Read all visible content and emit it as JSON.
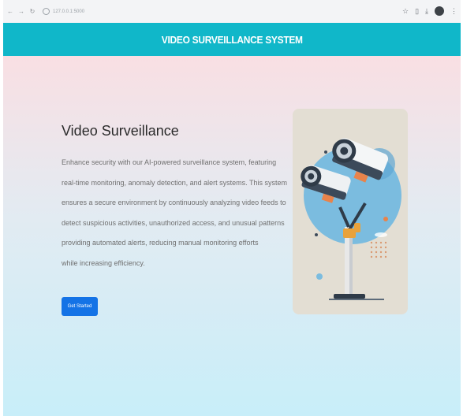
{
  "browser": {
    "url": "127.0.0.1:5000"
  },
  "header": {
    "title": "VIDEO SURVEILLANCE SYSTEM"
  },
  "hero": {
    "title": "Video Surveillance",
    "description": "Enhance security with our AI-powered surveillance system, featuring\nreal-time monitoring, anomaly detection, and alert systems. This system\nensures a secure environment by continuously analyzing video feeds to\ndetect suspicious activities, unauthorized access, and unusual patterns\nproviding automated alerts, reducing manual monitoring efforts\nwhile increasing efficiency.",
    "button_label": "Get Started"
  },
  "colors": {
    "header_bg": "#10b7c9",
    "button_bg": "#1473e6"
  }
}
